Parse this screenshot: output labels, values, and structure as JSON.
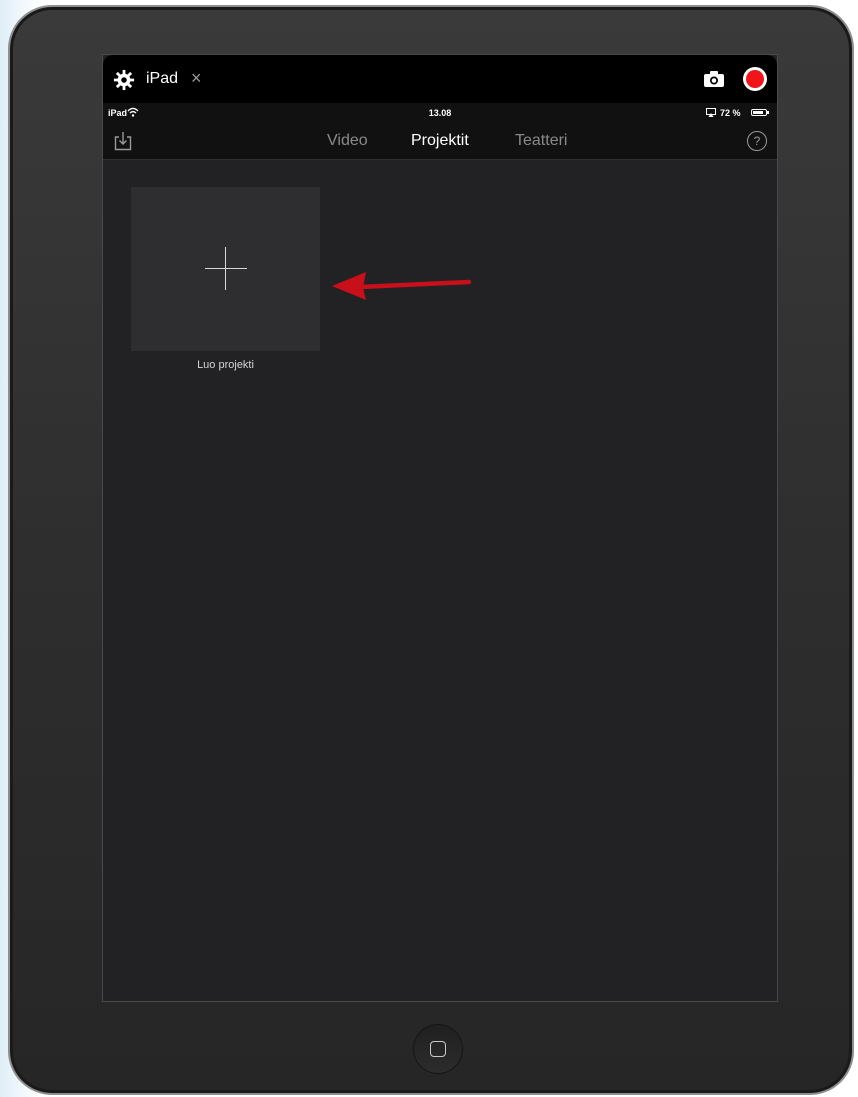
{
  "recorder_toolbar": {
    "tab_label": "iPad",
    "close_glyph": "×",
    "icons": [
      "settings-icon",
      "camera-icon",
      "record-icon"
    ],
    "record_color": "#f2141b"
  },
  "status_bar": {
    "device": "iPad",
    "time": "13.08",
    "battery": "72 %",
    "icons": [
      "wifi-icon",
      "airplay-icon",
      "battery-icon"
    ]
  },
  "nav": {
    "tabs": [
      {
        "label": "Video",
        "active": false
      },
      {
        "label": "Projektit",
        "active": true
      },
      {
        "label": "Teatteri",
        "active": false
      }
    ],
    "help_glyph": "?",
    "icons": [
      "import-icon",
      "help-icon"
    ]
  },
  "projects": {
    "create_label": "Luo projekti",
    "tile_icon": "plus-icon"
  },
  "annotation": {
    "arrow_color": "#c8101a",
    "icon": "arrow-left-icon"
  },
  "device": {
    "icons": [
      "home-button-icon"
    ]
  }
}
